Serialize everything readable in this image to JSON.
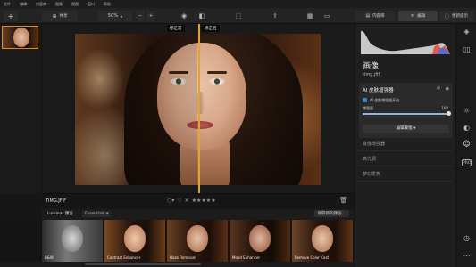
{
  "menubar": {
    "items": [
      "文件",
      "编辑",
      "内容库",
      "图像",
      "视图",
      "窗口",
      "帮助"
    ]
  },
  "toolbar": {
    "add_label": "+",
    "share_label": "共享",
    "zoom_value": "50%",
    "zoom_minus": "−",
    "zoom_plus": "+",
    "tabs": [
      "内容库",
      "编辑",
      "更新提示"
    ]
  },
  "canvas": {
    "before_label": "修正前",
    "after_label": "修正后"
  },
  "info": {
    "filename": "TIMG.JFIF",
    "rating_stars": 5,
    "rating_glyph": "★★★★★"
  },
  "presets_bar": {
    "tab_label": "Luminar 预设",
    "dropdown_label": "Essentials",
    "save_label": "保存新的预设..."
  },
  "presets": [
    {
      "label": "B&W"
    },
    {
      "label": "Contrast Enhancer"
    },
    {
      "label": "Haze Removal"
    },
    {
      "label": "Mood Enhancer"
    },
    {
      "label": "Remove Color Cast"
    }
  ],
  "right_panel": {
    "section_title": "画像",
    "file_name": "timg.jfif",
    "ai_card": {
      "title": "AI 皮肤增强器",
      "checkbox_label": "AI 皮肤增强器开启",
      "slider_label": "增强量",
      "slider_value": "100",
      "slider_fraction": 1.0,
      "edit_mask_label": "编辑蒙版 ▾"
    },
    "collapsed_sections": [
      "肖像增强器",
      "高光调",
      "梦幻柔焦"
    ]
  },
  "colors": {
    "accent_divider": "#e0a23a",
    "selected_thumb_border": "#d98a2b",
    "checkbox_blue": "#3b82d1"
  }
}
